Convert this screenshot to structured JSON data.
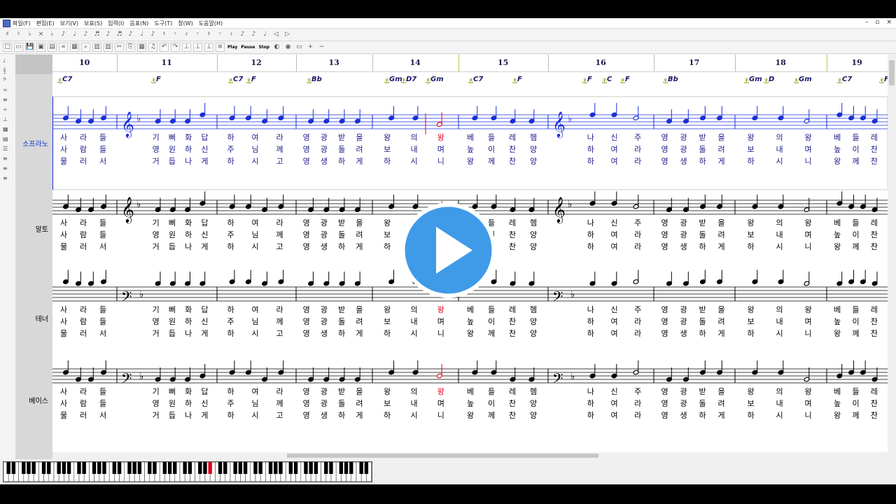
{
  "menu": {
    "items": [
      "파일(F)",
      "편집(E)",
      "보기(V)",
      "보표(S)",
      "입력(I)",
      "음표(N)",
      "도구(T)",
      "창(W)",
      "도움말(H)"
    ],
    "window_controls": [
      "–",
      "▫",
      "×"
    ]
  },
  "toolbar": {
    "transport": [
      "Play",
      "Pause",
      "Stop"
    ]
  },
  "measures": [
    "10",
    "11",
    "12",
    "13",
    "14",
    "15",
    "16",
    "17",
    "18",
    "19"
  ],
  "instruments": [
    "소프라노",
    "알토",
    "테너",
    "베이스"
  ],
  "chords": [
    "C7",
    "F",
    "C7",
    "F",
    "Bb",
    "Gm",
    "D7",
    "Gm",
    "C7",
    "F",
    "F",
    "C",
    "F",
    "Bb",
    "Gm",
    "D",
    "Gm",
    "C7",
    "F"
  ],
  "lyrics": {
    "line1": [
      "사",
      "라",
      "들",
      "기",
      "뻐",
      "화",
      "답",
      "하",
      "여",
      "라",
      "영",
      "광",
      "받",
      "을",
      "왕",
      "의",
      "왕",
      "베",
      "들",
      "레",
      "헴",
      "나",
      "신",
      "주",
      "영",
      "광",
      "받",
      "을",
      "왕",
      "의",
      "왕",
      "베",
      "들",
      "레"
    ],
    "line2": [
      "사",
      "람",
      "들",
      "영",
      "원",
      "하",
      "신",
      "주",
      "님",
      "께",
      "영",
      "광",
      "돌",
      "려",
      "보",
      "내",
      "며",
      "높",
      "이",
      "찬",
      "양",
      "하",
      "여",
      "라",
      "영",
      "광",
      "돌",
      "려",
      "보",
      "내",
      "며",
      "높",
      "이",
      "찬"
    ],
    "line3": [
      "물",
      "러",
      "서",
      "거",
      "듭",
      "나",
      "게",
      "하",
      "시",
      "고",
      "영",
      "생",
      "하",
      "게",
      "하",
      "시",
      "니",
      "왕",
      "께",
      "찬",
      "양",
      "하",
      "여",
      "라",
      "영",
      "생",
      "하",
      "게",
      "하",
      "시",
      "니",
      "왕",
      "께",
      "찬"
    ]
  },
  "colors": {
    "selected_staff": "#1a2fd6",
    "highlight": "#e0001b",
    "play_button": "#3f9ae8",
    "chord_marker": "#8a8a00"
  }
}
